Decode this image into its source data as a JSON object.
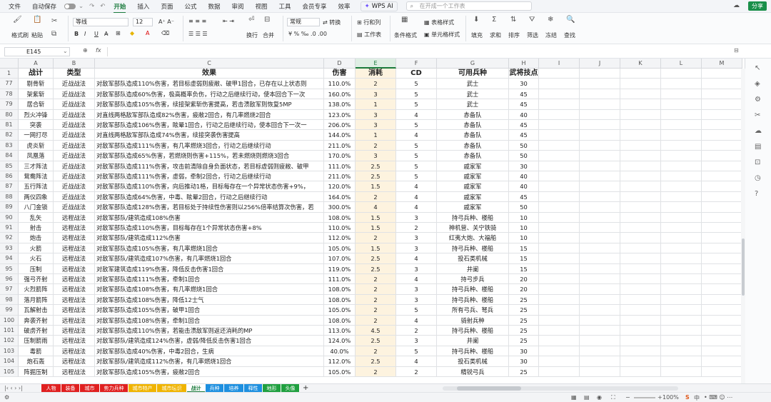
{
  "menubar": {
    "items": [
      "文件",
      "自动保存",
      "开始",
      "插入",
      "页面",
      "公式",
      "数据",
      "审阅",
      "视图",
      "工具",
      "会员专享",
      "效率"
    ],
    "active": "开始",
    "wps_ai": "WPS AI",
    "search_placeholder": "在开成一个工作表",
    "share": "分享"
  },
  "ribbon": {
    "format_painter": "格式刷",
    "paste": "粘贴",
    "font_name": "等线",
    "font_size": "12",
    "wrap": "换行",
    "merge": "合并",
    "number_format": "常规",
    "convert": "转换",
    "rows_cols": "行和列",
    "worksheet": "工作表",
    "cond_format": "条件格式",
    "table_style": "表格样式",
    "cell_style": "单元格样式",
    "fill": "填充",
    "sum": "求和",
    "sort": "排序",
    "filter": "筛选",
    "freeze": "冻结",
    "find": "查找"
  },
  "formula_bar": {
    "cell_ref": "E145",
    "fx": "fx"
  },
  "columns": [
    "A",
    "B",
    "C",
    "D",
    "E",
    "F",
    "G",
    "H",
    "I",
    "J",
    "K",
    "L",
    "M"
  ],
  "selected_column": "E",
  "header_row": {
    "num": "1",
    "cells": [
      "战计",
      "类型",
      "效果",
      "伤害",
      "消耗",
      "CD",
      "可用兵种",
      "武将技点"
    ]
  },
  "rows": [
    {
      "n": "77",
      "a": "剔骨斩",
      "b": "近战战法",
      "c": "对敌军部队造成110%伤害，若目标虚弱则疲敝、破甲1回合，已存在以上状态则",
      "d": "110.0%",
      "e": "2",
      "f": "5",
      "g": "武士",
      "h": "30"
    },
    {
      "n": "78",
      "a": "架紫斩",
      "b": "近战战法",
      "c": "对敌军部队造成60%伤害，极高概率负伤，行动之后继续行动，使本回合下一次",
      "d": "160.0%",
      "e": "3",
      "f": "5",
      "g": "武士",
      "h": "45"
    },
    {
      "n": "79",
      "a": "居合斩",
      "b": "近战战法",
      "c": "对敌军部队造成105%伤害，续接架紫斩伤害提高，若击溃敌军则恢复5MP",
      "d": "138.0%",
      "e": "1",
      "f": "5",
      "g": "武士",
      "h": "45"
    },
    {
      "n": "80",
      "a": "烈火冲锋",
      "b": "近战战法",
      "c": "对直线两格敌军部队造成82%伤害，疲敝2回合，有几率燃烧2回合",
      "d": "123.0%",
      "e": "3",
      "f": "4",
      "g": "赤备队",
      "h": "40"
    },
    {
      "n": "81",
      "a": "突袭",
      "b": "近战战法",
      "c": "对敌军部队造成106%伤害，眩晕1回合，行动之后继续行动，使本回合下一次一",
      "d": "206.0%",
      "e": "3",
      "f": "5",
      "g": "赤备队",
      "h": "45"
    },
    {
      "n": "82",
      "a": "一网打尽",
      "b": "近战战法",
      "c": "对直线两格敌军部队造成74%伤害，续接突袭伤害提高",
      "d": "144.0%",
      "e": "1",
      "f": "4",
      "g": "赤备队",
      "h": "45"
    },
    {
      "n": "83",
      "a": "虎炎斩",
      "b": "近战战法",
      "c": "对敌军部队造成111%伤害，有几率燃烧3回合，行动之后继续行动",
      "d": "211.0%",
      "e": "2",
      "f": "5",
      "g": "赤备队",
      "h": "50"
    },
    {
      "n": "84",
      "a": "凤凰落",
      "b": "近战战法",
      "c": "对敌军部队造成65%伤害，若燃烧则伤害+115%，若未燃烧则燃烧3回合",
      "d": "170.0%",
      "e": "3",
      "f": "5",
      "g": "赤备队",
      "h": "50"
    },
    {
      "n": "85",
      "a": "三才阵法",
      "b": "近战战法",
      "c": "对敌军部队造成111%伤害，攻击前清除自身负面状态，若目标虚弱则疲敝、破甲",
      "d": "111.0%",
      "e": "2.5",
      "f": "5",
      "g": "戚家军",
      "h": "30"
    },
    {
      "n": "86",
      "a": "鸳鸯阵法",
      "b": "近战战法",
      "c": "对敌军部队造成111%伤害，虚弱，牵制2回合，行动之后继续行动",
      "d": "211.0%",
      "e": "2.5",
      "f": "5",
      "g": "戚家军",
      "h": "40"
    },
    {
      "n": "87",
      "a": "五行阵法",
      "b": "近战战法",
      "c": "对敌军部队造成110%伤害，向后推动1格，目标每存在一个异常状态伤害+9%，",
      "d": "120.0%",
      "e": "1.5",
      "f": "4",
      "g": "戚家军",
      "h": "40"
    },
    {
      "n": "88",
      "a": "两仪四象",
      "b": "近战战法",
      "c": "对敌军部队造成64%伤害，中毒、眩晕2回合，行动之后继续行动",
      "d": "164.0%",
      "e": "2",
      "f": "4",
      "g": "戚家军",
      "h": "45"
    },
    {
      "n": "89",
      "a": "八门金锁",
      "b": "近战战法",
      "c": "对敌军部队造成128%伤害，若目标处于持续性伤害则以256%倍率结算次伤害，若",
      "d": "300.0%",
      "e": "4",
      "f": "4",
      "g": "戚家军",
      "h": "50"
    },
    {
      "n": "90",
      "a": "乱矢",
      "b": "远程战法",
      "c": "对敌军部队/建筑造成108%伤害",
      "d": "108.0%",
      "e": "1.5",
      "f": "3",
      "g": "持弓兵种、楼船",
      "h": "10"
    },
    {
      "n": "91",
      "a": "射击",
      "b": "远程战法",
      "c": "对敌军部队造成110%伤害，目标每存在1个异常状态伤害+8%",
      "d": "110.0%",
      "e": "1.5",
      "f": "2",
      "g": "神机营、关宁铁骑",
      "h": "10"
    },
    {
      "n": "92",
      "a": "炮击",
      "b": "远程战法",
      "c": "对敌军部队/建筑造成112%伤害",
      "d": "112.0%",
      "e": "2",
      "f": "3",
      "g": "红夷大炮、大福船",
      "h": "10"
    },
    {
      "n": "93",
      "a": "火箭",
      "b": "远程战法",
      "c": "对敌军部队造成105%伤害，有几率燃烧1回合",
      "d": "105.0%",
      "e": "1.5",
      "f": "3",
      "g": "持弓兵种、楼船",
      "h": "15"
    },
    {
      "n": "94",
      "a": "火石",
      "b": "远程战法",
      "c": "对敌军部队/建筑造成107%伤害，有几率燃烧1回合",
      "d": "107.0%",
      "e": "2.5",
      "f": "4",
      "g": "投石类机械",
      "h": "15"
    },
    {
      "n": "95",
      "a": "压制",
      "b": "远程战法",
      "c": "对敌军建筑造成119%伤害，降低反击伤害1回合",
      "d": "119.0%",
      "e": "2.5",
      "f": "3",
      "g": "井阑",
      "h": "15"
    },
    {
      "n": "96",
      "a": "强弓齐射",
      "b": "远程战法",
      "c": "对敌军部队造成111%伤害，牵制1回合",
      "d": "111.0%",
      "e": "2",
      "f": "4",
      "g": "持弓步兵",
      "h": "20"
    },
    {
      "n": "97",
      "a": "火烈箭阵",
      "b": "远程战法",
      "c": "对敌军部队造成108%伤害，有几率燃烧1回合",
      "d": "108.0%",
      "e": "2",
      "f": "3",
      "g": "持弓兵种、楼船",
      "h": "20"
    },
    {
      "n": "98",
      "a": "落月箭阵",
      "b": "远程战法",
      "c": "对敌军部队造成108%伤害，降低12士气",
      "d": "108.0%",
      "e": "2",
      "f": "3",
      "g": "持弓兵种、楼船",
      "h": "25"
    },
    {
      "n": "99",
      "a": "瓦解射击",
      "b": "远程战法",
      "c": "对敌军部队造成105%伤害，破甲1回合",
      "d": "105.0%",
      "e": "2",
      "f": "5",
      "g": "所有弓兵、弩兵",
      "h": "25"
    },
    {
      "n": "100",
      "a": "奔袭齐射",
      "b": "远程战法",
      "c": "对敌军部队造成108%伤害，牵制1回合",
      "d": "108.0%",
      "e": "2",
      "f": "4",
      "g": "骑射兵种",
      "h": "25"
    },
    {
      "n": "101",
      "a": "破虏齐射",
      "b": "远程战法",
      "c": "对敌军部队造成110%伤害，若能击溃敌军则返还消耗的MP",
      "d": "113.0%",
      "e": "4.5",
      "f": "2",
      "g": "持弓兵种、楼船",
      "h": "25"
    },
    {
      "n": "102",
      "a": "压制箭雨",
      "b": "远程战法",
      "c": "对敌军部队/建筑造成124%伤害，虚弱/降低反击伤害1回合",
      "d": "124.0%",
      "e": "2.5",
      "f": "3",
      "g": "井阑",
      "h": "25"
    },
    {
      "n": "103",
      "a": "毒箭",
      "b": "远程战法",
      "c": "对敌军部队造成40%伤害，中毒2回合，生病",
      "d": "40.0%",
      "e": "2",
      "f": "5",
      "g": "持弓兵种、楼船",
      "h": "30"
    },
    {
      "n": "104",
      "a": "炮石轰",
      "b": "远程战法",
      "c": "对敌军部队/建筑造成112%伤害，有几率燃烧1回合",
      "d": "112.0%",
      "e": "2.5",
      "f": "4",
      "g": "投石类机械",
      "h": "30"
    },
    {
      "n": "105",
      "a": "阵掘压制",
      "b": "远程战法",
      "c": "对敌军部队造成105%伤害，疲敝2回合",
      "d": "105.0%",
      "e": "2",
      "f": "2",
      "g": "精锐弓兵",
      "h": "25"
    }
  ],
  "sheet_tabs": [
    {
      "label": "人物",
      "color": "#e02020"
    },
    {
      "label": "装备",
      "color": "#e02020"
    },
    {
      "label": "城市",
      "color": "#e02020"
    },
    {
      "label": "势力兵种",
      "color": "#e02020"
    },
    {
      "label": "城市特产",
      "color": "#f0b400"
    },
    {
      "label": "城市坛识",
      "color": "#f0b400"
    },
    {
      "label": "战计",
      "color": "#ffffff"
    },
    {
      "label": "兵种",
      "color": "#1e90e0"
    },
    {
      "label": "培养",
      "color": "#1e90e0"
    },
    {
      "label": "释性",
      "color": "#1e90e0"
    },
    {
      "label": "地形",
      "color": "#20a040"
    },
    {
      "label": "头像",
      "color": "#20a040"
    }
  ],
  "active_tab": "战计",
  "status": {
    "zoom": "100%",
    "lang": "中"
  }
}
